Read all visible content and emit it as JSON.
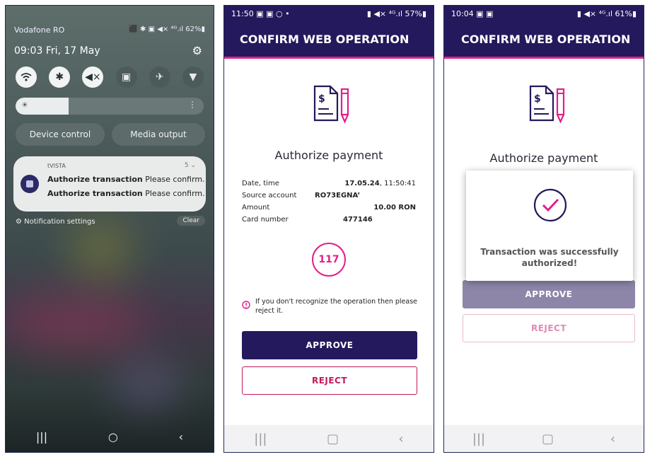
{
  "screen1": {
    "carrier": "Vodafone RO",
    "status_icons": "⬛ ✱ ▣ ◀× ⁴ᴳ.ıl 62%▮",
    "time": "09:03",
    "date": "Fri, 17 May",
    "device_control": "Device control",
    "media_output": "Media output",
    "notification": {
      "app": "tVISTA",
      "count": "5",
      "line1_bold": "Authorize transaction",
      "line1_rest": " Please confirm.",
      "line2_bold": "Authorize transaction",
      "line2_rest": " Please confirm."
    },
    "notification_settings": "Notification settings",
    "clear": "Clear"
  },
  "screen2": {
    "status_time": "11:50",
    "status_icons": "▮ ◀× ⁴ᴳ.ıl 57%▮",
    "header": "CONFIRM WEB OPERATION",
    "title": "Authorize payment",
    "rows": [
      {
        "label": "Date, time",
        "value_bold": "17.05.24",
        "value_rest": ", 11:50:41"
      },
      {
        "label": "Source account",
        "value_bold": "RO73EGNA’",
        "value_rest": ""
      },
      {
        "label": "Amount",
        "value_bold": "10.00 RON",
        "value_rest": ""
      },
      {
        "label": "Card number",
        "value_bold": "477146",
        "value_rest": ""
      }
    ],
    "timer": "117",
    "warning": "If you don't recognize the operation then please reject it.",
    "approve": "APPROVE",
    "reject": "REJECT"
  },
  "screen3": {
    "status_time": "10:04",
    "status_icons": "▮ ◀× ⁴ᴳ.ıl 61%▮",
    "header": "CONFIRM WEB OPERATION",
    "title": "Authorize payment",
    "success": "Transaction was successfully authorized!",
    "approve": "APPROVE",
    "reject": "REJECT"
  },
  "colors": {
    "navy": "#24195c",
    "pink": "#e21f8a"
  }
}
